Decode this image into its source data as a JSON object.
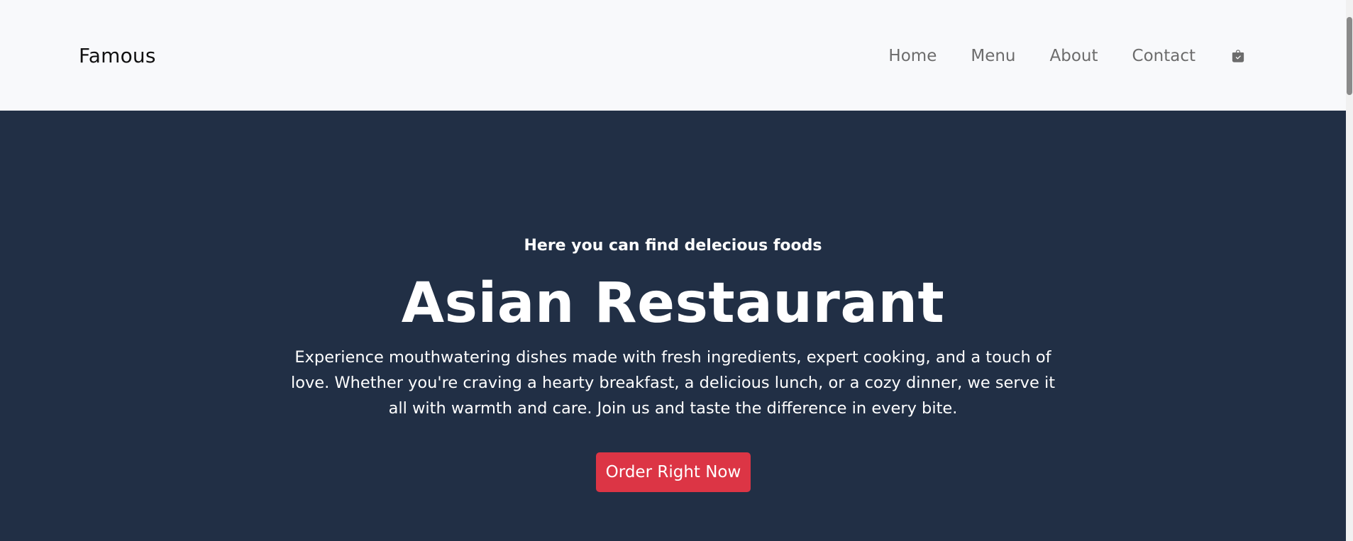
{
  "navbar": {
    "brand": "Famous",
    "links": [
      {
        "label": "Home"
      },
      {
        "label": "Menu"
      },
      {
        "label": "About"
      },
      {
        "label": "Contact"
      }
    ],
    "cart_icon": "shopping-bag-check-icon"
  },
  "hero": {
    "eyebrow": "Here you can find delecious foods",
    "title": "Asian Restaurant",
    "description": "Experience mouthwatering dishes made with fresh ingredients, expert cooking, and a touch of love. Whether you're craving a hearty breakfast, a delicious lunch, or a cozy dinner, we serve it all with warmth and care. Join us and taste the difference in every bite.",
    "cta_label": "Order Right Now"
  },
  "colors": {
    "navbar_bg": "#f8f9fb",
    "hero_bg": "#212f45",
    "cta_bg": "#dc3545",
    "nav_text": "#6c6c6c"
  }
}
